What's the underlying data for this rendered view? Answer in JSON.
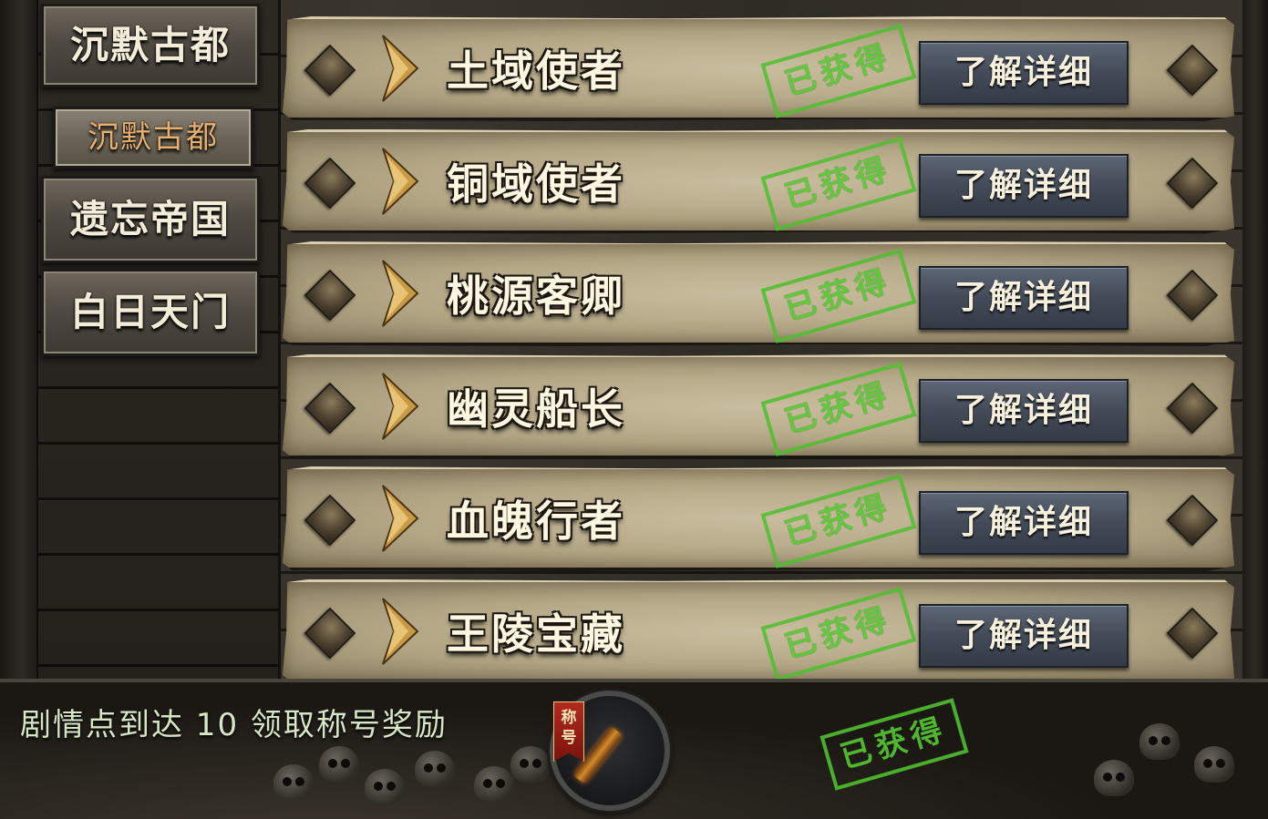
{
  "sidebar": {
    "tabs": [
      {
        "label": "沉默古都"
      },
      {
        "label": "沉默古都"
      },
      {
        "label": "遗忘帝国"
      },
      {
        "label": "白日天门"
      }
    ]
  },
  "rows": [
    {
      "title": "土域使者",
      "stamp": "已获得",
      "button": "了解详细"
    },
    {
      "title": "铜域使者",
      "stamp": "已获得",
      "button": "了解详细"
    },
    {
      "title": "桃源客卿",
      "stamp": "已获得",
      "button": "了解详细"
    },
    {
      "title": "幽灵船长",
      "stamp": "已获得",
      "button": "了解详细"
    },
    {
      "title": "血魄行者",
      "stamp": "已获得",
      "button": "了解详细"
    },
    {
      "title": "王陵宝藏",
      "stamp": "已获得",
      "button": "了解详细"
    }
  ],
  "bottom": {
    "text": "剧情点到达 10 领取称号奖励",
    "badge_label": "称号",
    "stamp": "已获得"
  },
  "icons": {
    "row_left": "diamond-stud-icon",
    "row_right": "diamond-stud-icon",
    "chevron": "gold-chevron-icon",
    "medal": "torch-medal-icon",
    "skulls": "skull-pile-icon"
  },
  "colors": {
    "stamp_green": "#4fbf2e",
    "parchment": "#b3a685",
    "button_slate": "#434b58",
    "tab_sub_text": "#e8b070"
  }
}
